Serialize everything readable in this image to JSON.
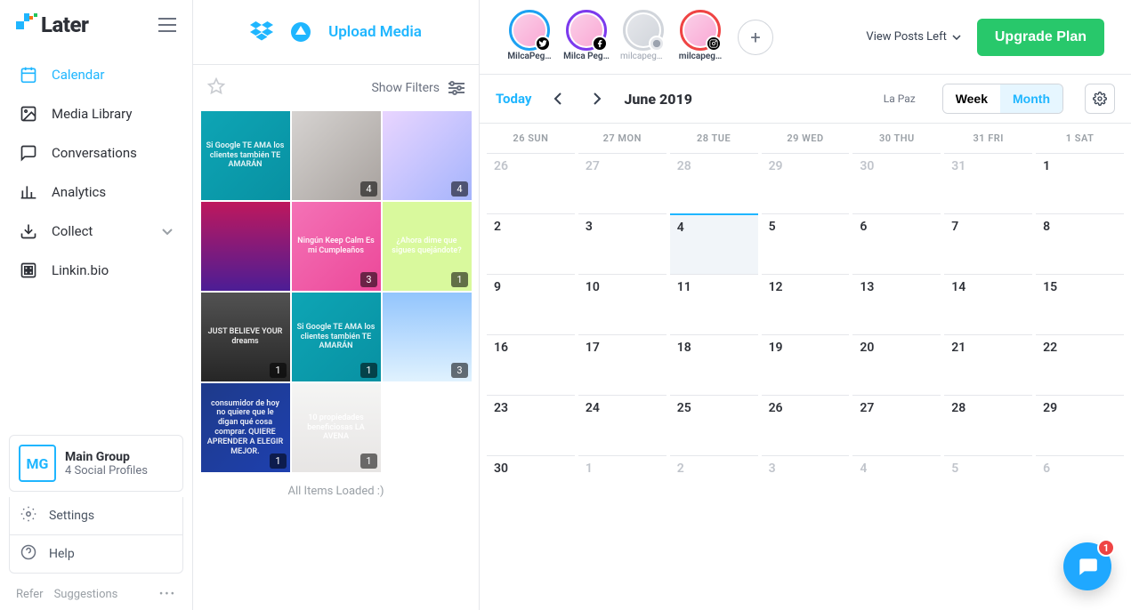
{
  "brand": {
    "name": "Later"
  },
  "sidebar": {
    "items": [
      {
        "label": "Calendar",
        "active": true
      },
      {
        "label": "Media Library"
      },
      {
        "label": "Conversations"
      },
      {
        "label": "Analytics"
      },
      {
        "label": "Collect",
        "expandable": true
      },
      {
        "label": "Linkin.bio"
      }
    ],
    "group": {
      "badge": "MG",
      "title": "Main Group",
      "subtitle": "4 Social Profiles"
    },
    "settings": [
      {
        "label": "Settings"
      },
      {
        "label": "Help"
      }
    ],
    "bottom": {
      "refer": "Refer",
      "suggestions": "Suggestions"
    }
  },
  "media_panel": {
    "upload_label": "Upload Media",
    "show_filters": "Show Filters",
    "all_loaded": "All Items Loaded :)",
    "thumbs": [
      {
        "caption": "Si Google TE AMA los clientes también TE AMARÁN",
        "cls": "t1"
      },
      {
        "caption": "",
        "cls": "t2",
        "count": "4"
      },
      {
        "caption": "",
        "cls": "t3",
        "count": "4"
      },
      {
        "caption": "",
        "cls": "t4"
      },
      {
        "caption": "Ningún Keep Calm Es mi Cumpleaños",
        "cls": "t5",
        "count": "3"
      },
      {
        "caption": "¿Ahora dime que sigues quejándote?",
        "cls": "t6",
        "count": "1"
      },
      {
        "caption": "JUST BELIEVE YOUR dreams",
        "cls": "t7",
        "count": "1"
      },
      {
        "caption": "Si Google TE AMA los clientes también TE AMARÁN",
        "cls": "t8",
        "count": "1"
      },
      {
        "caption": "",
        "cls": "t9",
        "count": "3"
      },
      {
        "caption": "consumidor de hoy no quiere que le digan qué cosa comprar. QUIERE APRENDER A ELEGIR MEJOR.",
        "cls": "t10",
        "count": "1"
      },
      {
        "caption": "10 propiedades beneficiosas LA AVENA",
        "cls": "t11",
        "count": "1"
      }
    ]
  },
  "profiles": [
    {
      "name": "MilcaPeg…",
      "network": "twitter",
      "ring": "#1da1f2",
      "muted": false
    },
    {
      "name": "Milca Peg…",
      "network": "facebook",
      "ring": "#7c3aed",
      "muted": false
    },
    {
      "name": "milcapegu…",
      "network": "pinterest",
      "ring": "#d1d5db",
      "muted": true
    },
    {
      "name": "milcapeg…",
      "network": "instagram",
      "ring": "#ef4444",
      "muted": false
    }
  ],
  "header": {
    "view_posts": "View Posts Left",
    "upgrade": "Upgrade Plan"
  },
  "calendar": {
    "today_label": "Today",
    "month_label": "June 2019",
    "timezone": "La Paz",
    "view": {
      "week": "Week",
      "month": "Month",
      "active": "month"
    },
    "dow": [
      "26 SUN",
      "27 MON",
      "28 TUE",
      "29 WED",
      "30 THU",
      "31 FRI",
      "1 SAT"
    ],
    "weeks": [
      [
        {
          "n": "26",
          "other": true
        },
        {
          "n": "27",
          "other": true
        },
        {
          "n": "28",
          "other": true
        },
        {
          "n": "29",
          "other": true
        },
        {
          "n": "30",
          "other": true
        },
        {
          "n": "31",
          "other": true
        },
        {
          "n": "1"
        }
      ],
      [
        {
          "n": "2"
        },
        {
          "n": "3"
        },
        {
          "n": "4",
          "today": true
        },
        {
          "n": "5"
        },
        {
          "n": "6"
        },
        {
          "n": "7"
        },
        {
          "n": "8"
        }
      ],
      [
        {
          "n": "9"
        },
        {
          "n": "10"
        },
        {
          "n": "11"
        },
        {
          "n": "12"
        },
        {
          "n": "13"
        },
        {
          "n": "14"
        },
        {
          "n": "15"
        }
      ],
      [
        {
          "n": "16"
        },
        {
          "n": "17"
        },
        {
          "n": "18"
        },
        {
          "n": "19"
        },
        {
          "n": "20"
        },
        {
          "n": "21"
        },
        {
          "n": "22"
        }
      ],
      [
        {
          "n": "23"
        },
        {
          "n": "24"
        },
        {
          "n": "25"
        },
        {
          "n": "26"
        },
        {
          "n": "27"
        },
        {
          "n": "28"
        },
        {
          "n": "29"
        }
      ],
      [
        {
          "n": "30"
        },
        {
          "n": "1",
          "other": true
        },
        {
          "n": "2",
          "other": true
        },
        {
          "n": "3",
          "other": true
        },
        {
          "n": "4",
          "other": true
        },
        {
          "n": "5",
          "other": true
        },
        {
          "n": "6",
          "other": true
        }
      ]
    ]
  },
  "chat": {
    "unread": "1"
  }
}
